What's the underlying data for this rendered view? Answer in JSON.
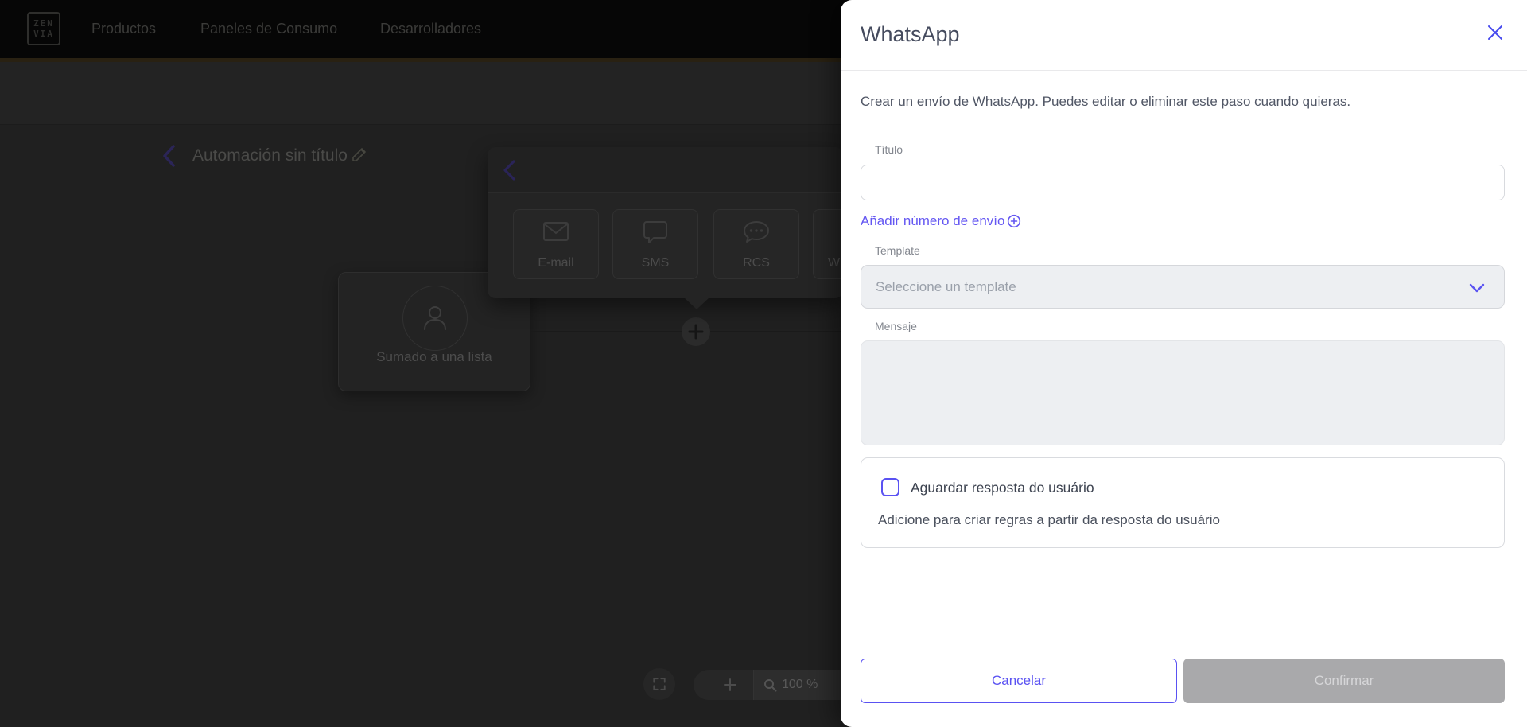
{
  "navbar": {
    "logo": {
      "top": "ZEN",
      "bottom": "VIA"
    },
    "items": [
      {
        "label": "Productos"
      },
      {
        "label": "Paneles de Consumo"
      },
      {
        "label": "Desarrolladores"
      }
    ]
  },
  "toolbar": {
    "automation_title": "Automación sin título"
  },
  "canvas": {
    "node_label": "Sumado a una lista",
    "channels": [
      {
        "label": "E-mail"
      },
      {
        "label": "SMS"
      },
      {
        "label": "RCS"
      },
      {
        "label": "W"
      }
    ],
    "zoom_level": "100 %"
  },
  "drawer": {
    "title": "WhatsApp",
    "description": "Crear un envío de WhatsApp. Puedes editar o eliminar este paso cuando quieras.",
    "fields": {
      "titulo": {
        "label": "Título",
        "value": ""
      },
      "template": {
        "label": "Template",
        "placeholder": "Seleccione un template"
      },
      "mensaje": {
        "label": "Mensaje",
        "value": ""
      }
    },
    "add_number_link": "Añadir número de envío",
    "await_response": {
      "label": "Aguardar resposta do usuário",
      "help": "Adicione para criar regras a partir da resposta do usuário"
    },
    "actions": {
      "cancel": "Cancelar",
      "confirm": "Confirmar"
    }
  },
  "colors": {
    "accent": "#5a52f2",
    "link": "#6457f2",
    "close_icon": "#4649ee",
    "confirm_disabled_bg": "#a9a9ab",
    "gold_line": "#292112"
  }
}
